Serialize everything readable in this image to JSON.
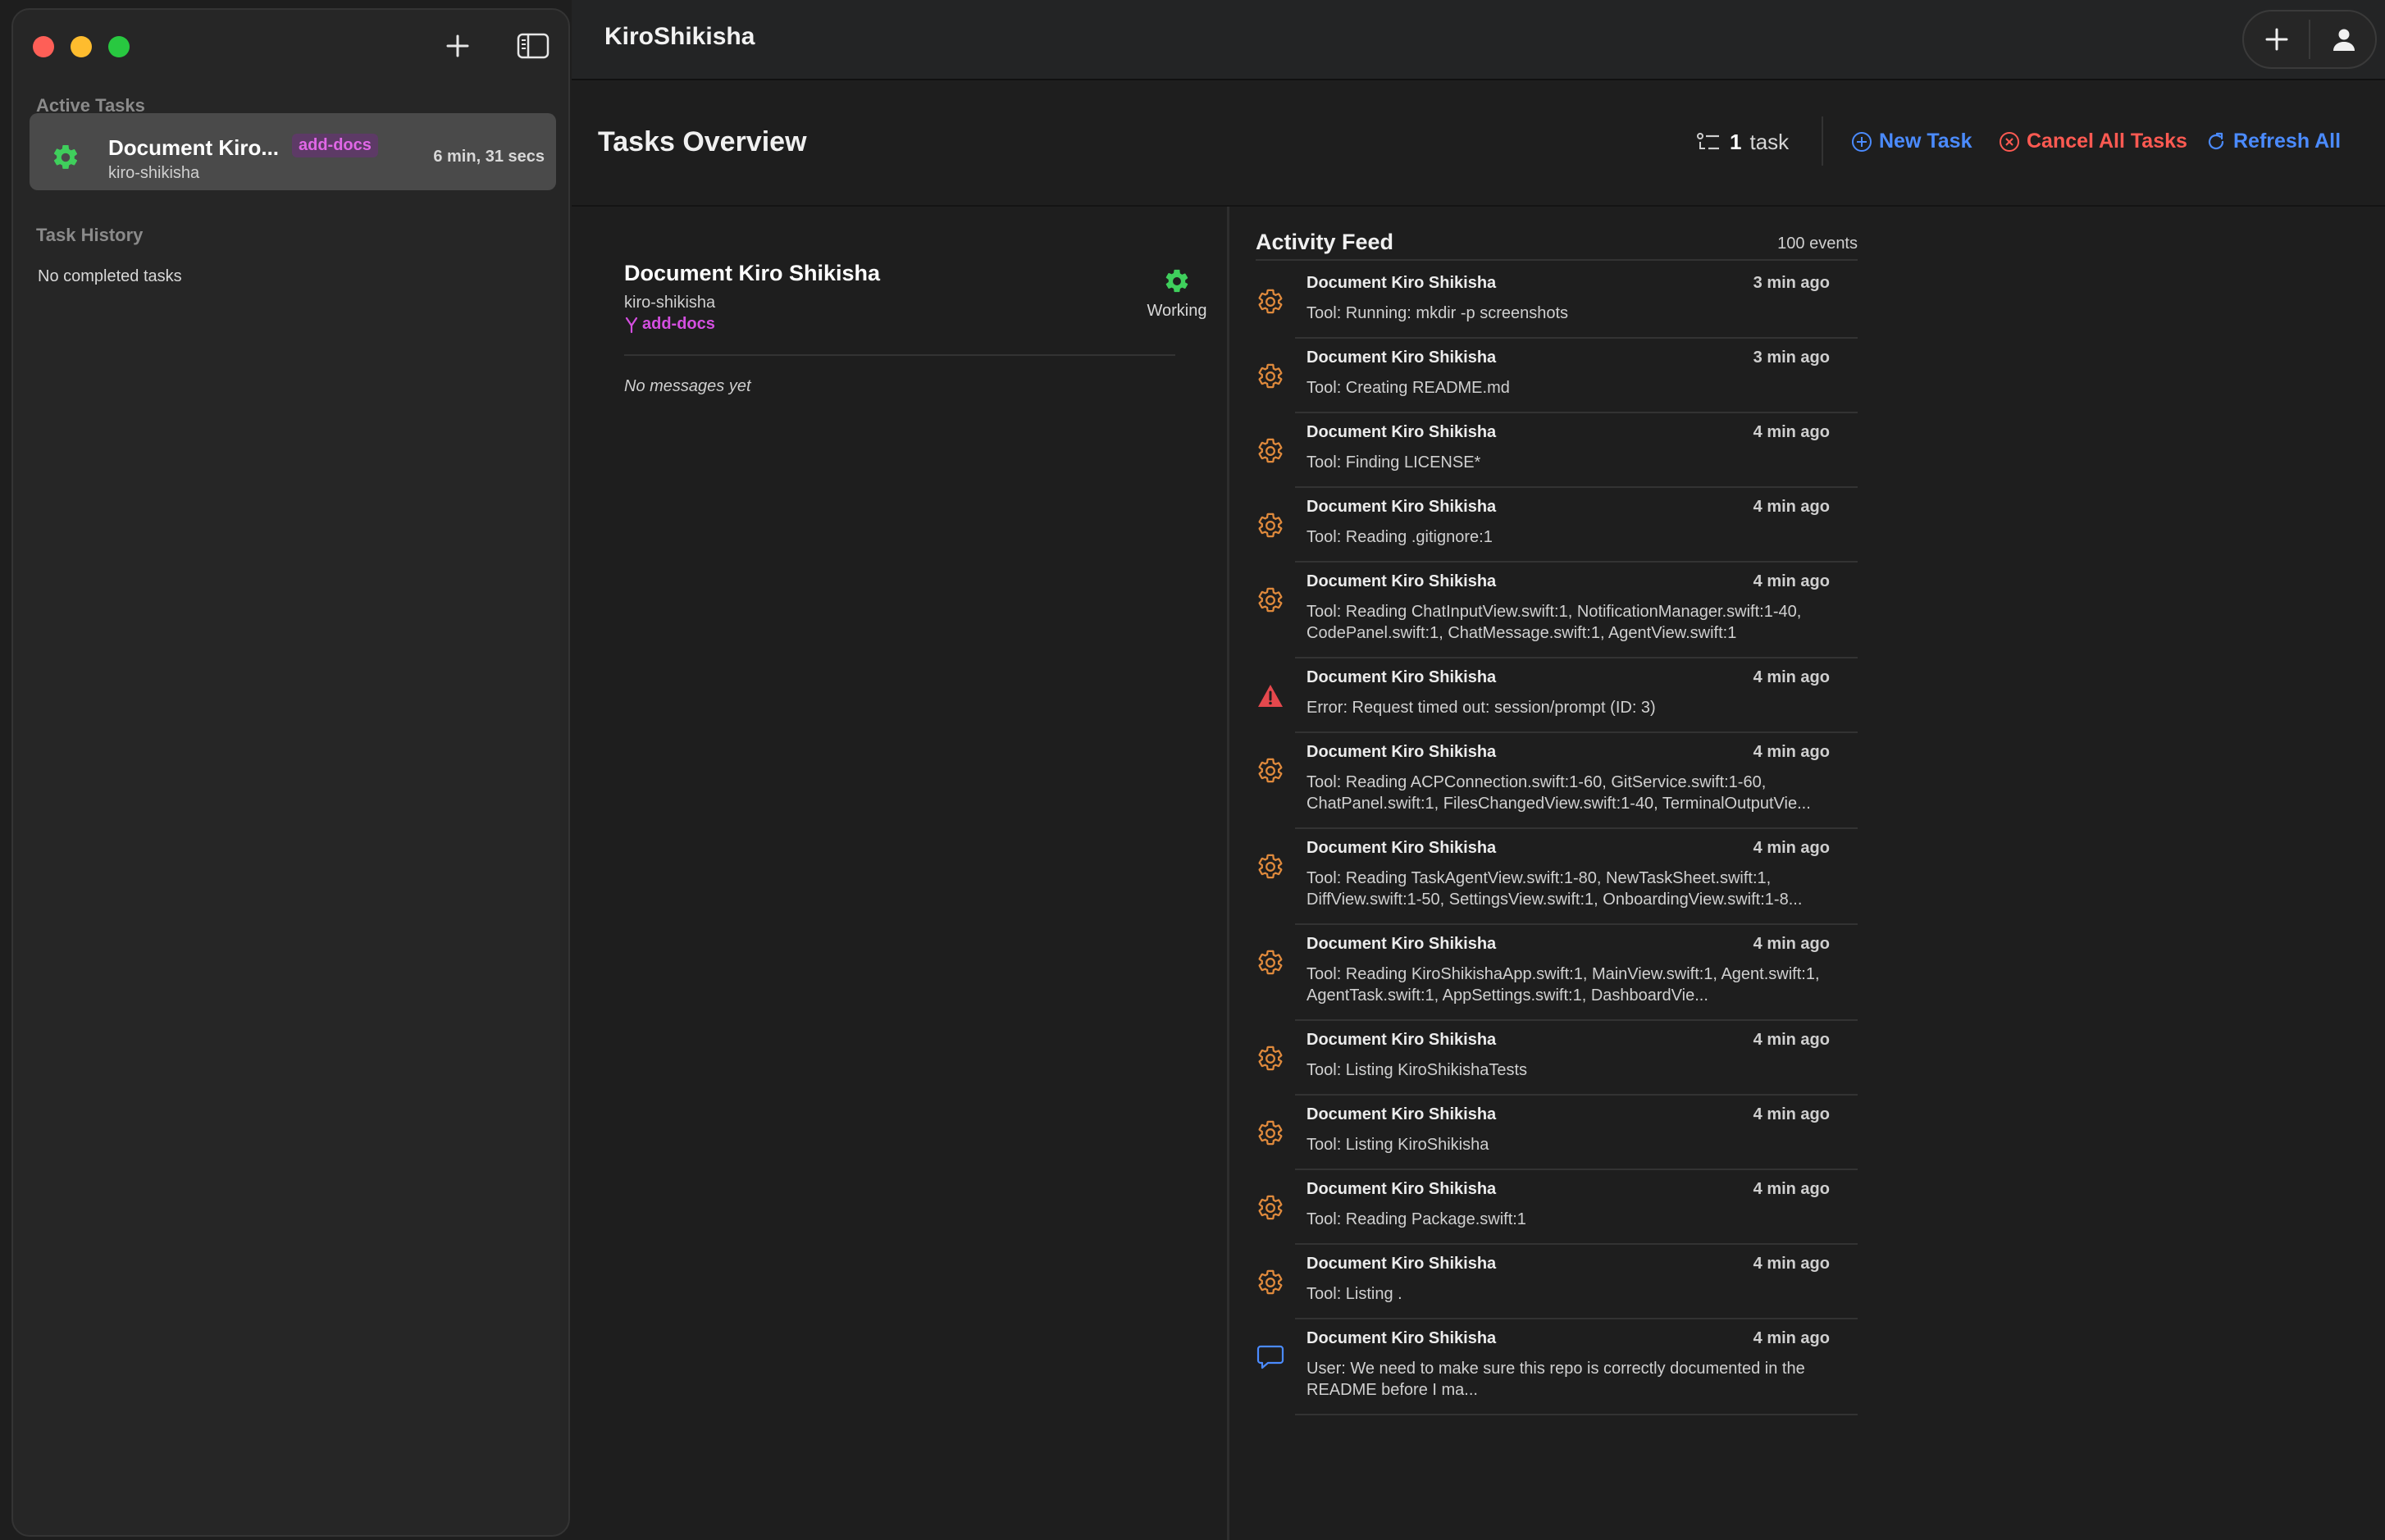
{
  "sidebar": {
    "active_label": "Active Tasks",
    "history_label": "Task History",
    "history_empty": "No completed tasks",
    "active_task": {
      "title": "Document Kiro...",
      "branch_badge": "add-docs",
      "repo": "kiro-shikisha",
      "elapsed": "6 min, 31 secs"
    }
  },
  "topbar": {
    "title": "KiroShikisha"
  },
  "overview": {
    "title": "Tasks Overview",
    "count": "1",
    "count_unit": "task",
    "new_task": "New Task",
    "cancel_all": "Cancel All Tasks",
    "refresh_all": "Refresh All"
  },
  "detail": {
    "title": "Document Kiro Shikisha",
    "repo": "kiro-shikisha",
    "branch": "add-docs",
    "status": "Working",
    "empty": "No messages yet"
  },
  "feed": {
    "title": "Activity Feed",
    "count": "100 events",
    "events": [
      {
        "type": "gear-icon",
        "title": "Document Kiro Shikisha",
        "time": "3 min ago",
        "text": "Tool: Running: mkdir -p screenshots"
      },
      {
        "type": "gear-icon",
        "title": "Document Kiro Shikisha",
        "time": "3 min ago",
        "text": "Tool: Creating README.md"
      },
      {
        "type": "gear-icon",
        "title": "Document Kiro Shikisha",
        "time": "4 min ago",
        "text": "Tool: Finding LICENSE*"
      },
      {
        "type": "gear-icon",
        "title": "Document Kiro Shikisha",
        "time": "4 min ago",
        "text": "Tool: Reading .gitignore:1"
      },
      {
        "type": "gear-icon",
        "title": "Document Kiro Shikisha",
        "time": "4 min ago",
        "text": "Tool: Reading ChatInputView.swift:1, NotificationManager.swift:1-40, CodePanel.swift:1, ChatMessage.swift:1, AgentView.swift:1"
      },
      {
        "type": "warning-icon",
        "title": "Document Kiro Shikisha",
        "time": "4 min ago",
        "text": "Error: Request timed out: session/prompt (ID: 3)"
      },
      {
        "type": "gear-icon",
        "title": "Document Kiro Shikisha",
        "time": "4 min ago",
        "text": "Tool: Reading ACPConnection.swift:1-60, GitService.swift:1-60, ChatPanel.swift:1, FilesChangedView.swift:1-40, TerminalOutputVie..."
      },
      {
        "type": "gear-icon",
        "title": "Document Kiro Shikisha",
        "time": "4 min ago",
        "text": "Tool: Reading TaskAgentView.swift:1-80, NewTaskSheet.swift:1, DiffView.swift:1-50, SettingsView.swift:1, OnboardingView.swift:1-8..."
      },
      {
        "type": "gear-icon",
        "title": "Document Kiro Shikisha",
        "time": "4 min ago",
        "text": "Tool: Reading KiroShikishaApp.swift:1, MainView.swift:1, Agent.swift:1, AgentTask.swift:1, AppSettings.swift:1, DashboardVie..."
      },
      {
        "type": "gear-icon",
        "title": "Document Kiro Shikisha",
        "time": "4 min ago",
        "text": "Tool: Listing KiroShikishaTests"
      },
      {
        "type": "gear-icon",
        "title": "Document Kiro Shikisha",
        "time": "4 min ago",
        "text": "Tool: Listing KiroShikisha"
      },
      {
        "type": "gear-icon",
        "title": "Document Kiro Shikisha",
        "time": "4 min ago",
        "text": "Tool: Reading Package.swift:1"
      },
      {
        "type": "gear-icon",
        "title": "Document Kiro Shikisha",
        "time": "4 min ago",
        "text": "Tool: Listing ."
      },
      {
        "type": "chat-bubble-icon",
        "title": "Document Kiro Shikisha",
        "time": "4 min ago",
        "text": "User: We need to make sure this repo is correctly documented in the README before I ma..."
      }
    ]
  },
  "colors": {
    "accent": "#4b8bff",
    "danger": "#ff5a52",
    "branch": "#d44fe0",
    "working": "#3fcf5c",
    "tool_icon": "#e08a3c"
  }
}
